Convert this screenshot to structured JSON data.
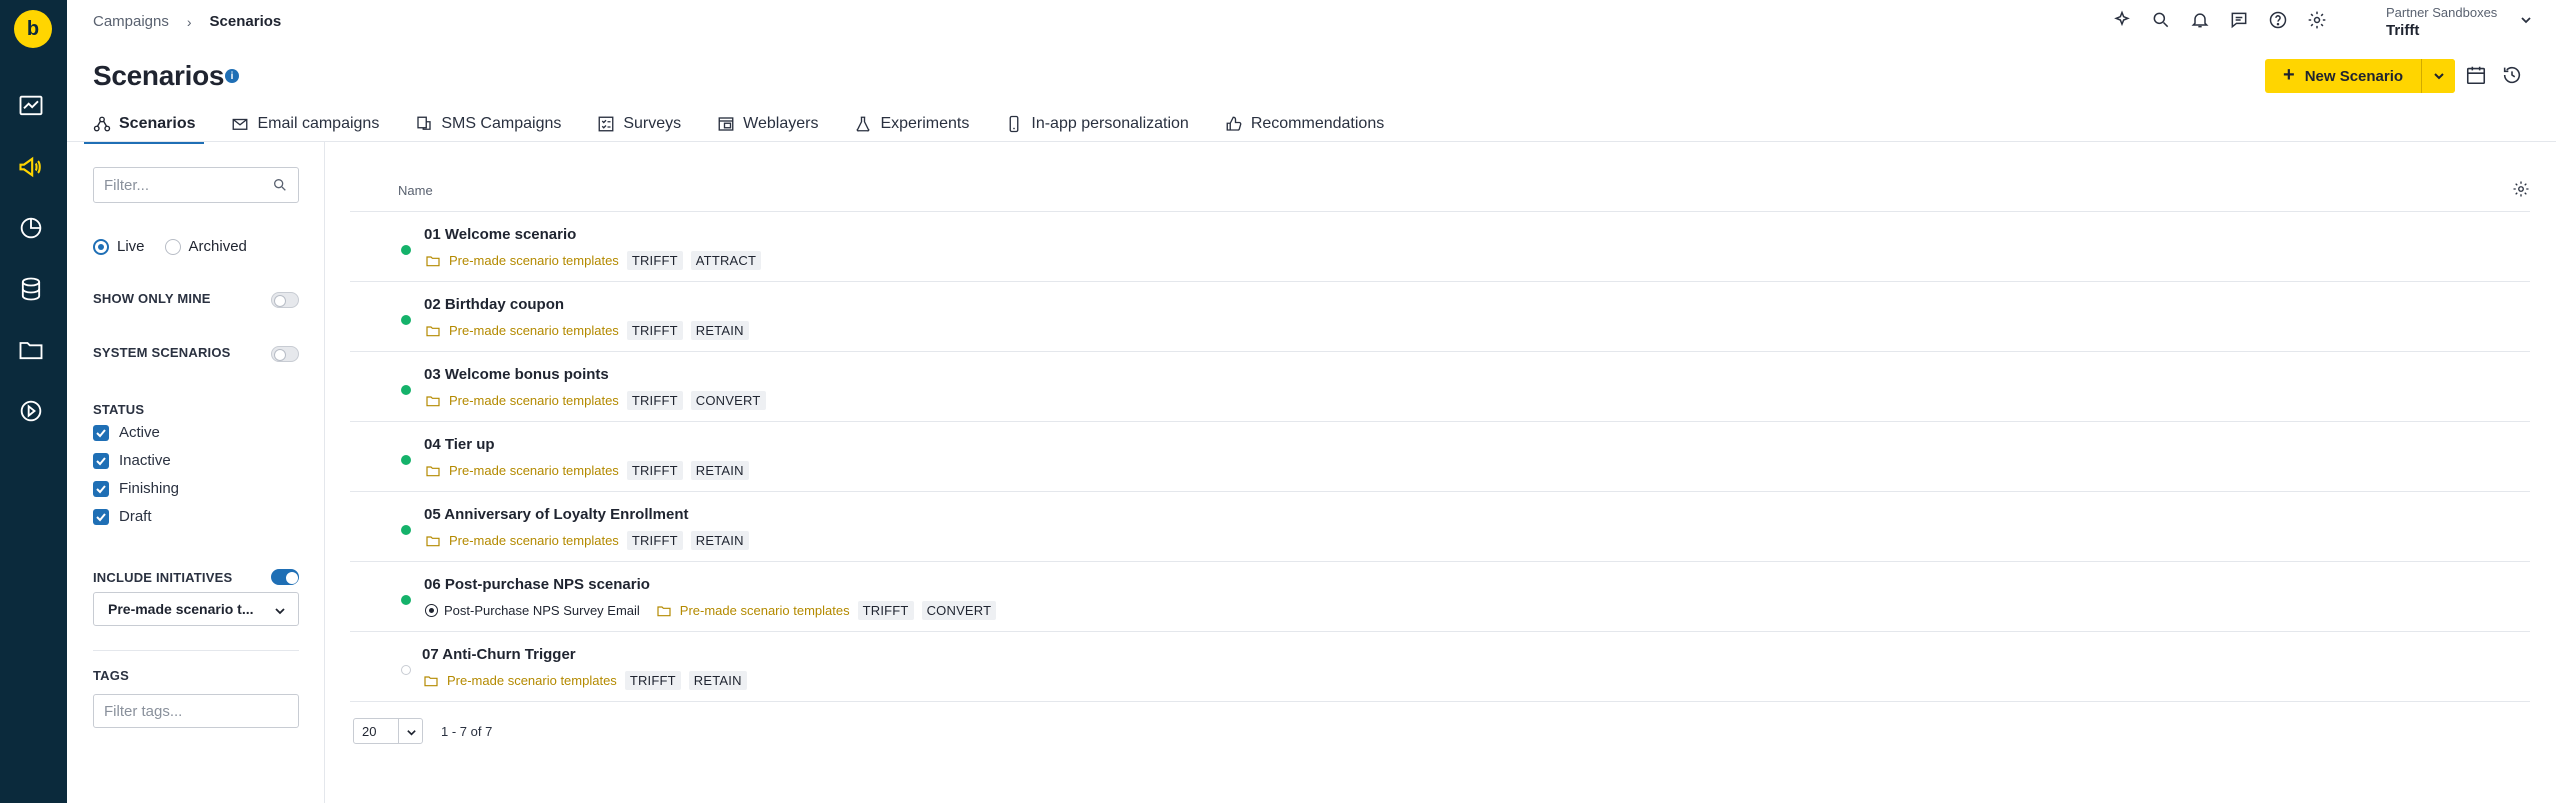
{
  "breadcrumb": {
    "parent": "Campaigns",
    "current": "Scenarios"
  },
  "project": {
    "org": "Partner Sandboxes",
    "name": "Trifft"
  },
  "page": {
    "title": "Scenarios",
    "new_button": "New Scenario"
  },
  "tabs": [
    {
      "label": "Scenarios",
      "icon": "scenario-icon",
      "active": true
    },
    {
      "label": "Email campaigns",
      "icon": "mail-icon"
    },
    {
      "label": "SMS Campaigns",
      "icon": "sms-icon"
    },
    {
      "label": "Surveys",
      "icon": "survey-icon"
    },
    {
      "label": "Weblayers",
      "icon": "weblayer-icon"
    },
    {
      "label": "Experiments",
      "icon": "flask-icon"
    },
    {
      "label": "In-app personalization",
      "icon": "phone-icon"
    },
    {
      "label": "Recommendations",
      "icon": "thumbs-up-icon"
    }
  ],
  "filters": {
    "search_placeholder": "Filter...",
    "radio": {
      "live": "Live",
      "archived": "Archived"
    },
    "show_only_mine": "SHOW ONLY MINE",
    "system_scenarios": "SYSTEM SCENARIOS",
    "status_heading": "STATUS",
    "statuses": [
      "Active",
      "Inactive",
      "Finishing",
      "Draft"
    ],
    "include_initiatives": "INCLUDE INITIATIVES",
    "initiative_select": "Pre-made scenario t...",
    "tags_heading": "TAGS",
    "tags_placeholder": "Filter tags..."
  },
  "table": {
    "header_name": "Name",
    "rows": [
      {
        "name": "01 Welcome scenario",
        "folder": "Pre-made scenario templates",
        "tags": [
          "TRIFFT",
          "ATTRACT"
        ],
        "active": true
      },
      {
        "name": "02 Birthday coupon",
        "folder": "Pre-made scenario templates",
        "tags": [
          "TRIFFT",
          "RETAIN"
        ],
        "active": true
      },
      {
        "name": "03 Welcome bonus points",
        "folder": "Pre-made scenario templates",
        "tags": [
          "TRIFFT",
          "CONVERT"
        ],
        "active": true
      },
      {
        "name": "04 Tier up",
        "folder": "Pre-made scenario templates",
        "tags": [
          "TRIFFT",
          "RETAIN"
        ],
        "active": true
      },
      {
        "name": "05 Anniversary of Loyalty Enrollment",
        "folder": "Pre-made scenario templates",
        "tags": [
          "TRIFFT",
          "RETAIN"
        ],
        "active": true
      },
      {
        "name": "06 Post-purchase NPS scenario",
        "linked": "Post-Purchase NPS Survey Email",
        "folder": "Pre-made scenario templates",
        "tags": [
          "TRIFFT",
          "CONVERT"
        ],
        "active": true
      },
      {
        "name": "07 Anti-Churn Trigger",
        "folder": "Pre-made scenario templates",
        "tags": [
          "TRIFFT",
          "RETAIN"
        ],
        "active": false
      }
    ]
  },
  "pagination": {
    "page_size": "20",
    "range": "1 - 7 of 7"
  },
  "colors": {
    "accent": "#1f6fb5",
    "brand_yellow": "#ffd500",
    "rail": "#0b2a3c",
    "folder": "#b48a00",
    "status_active": "#14b26a"
  }
}
